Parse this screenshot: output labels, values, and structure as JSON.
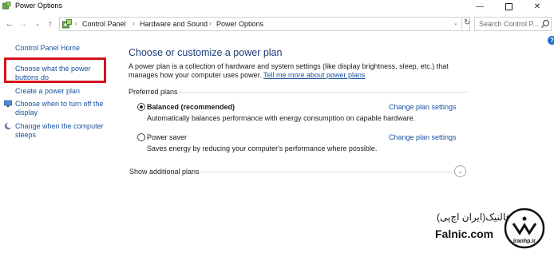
{
  "window": {
    "title": "Power Options",
    "minimize_glyph": "—",
    "close_glyph": "✕"
  },
  "address": {
    "back_glyph": "←",
    "forward_glyph": "→",
    "up_glyph": "↑",
    "dropdown_glyph": "⌄",
    "breadcrumb": [
      "Control Panel",
      "Hardware and Sound",
      "Power Options"
    ],
    "separator": "›",
    "refresh_glyph": "↻"
  },
  "search": {
    "placeholder": "Search Control P..."
  },
  "sidebar": {
    "home_label": "Control Panel Home",
    "items": [
      {
        "line1": "Choose what the power",
        "line2": "buttons do"
      },
      {
        "line1": "Create a power plan",
        "line2": ""
      },
      {
        "line1": "Choose when to turn off the",
        "line2": "display"
      },
      {
        "line1": "Change when the computer",
        "line2": "sleeps"
      }
    ]
  },
  "main": {
    "title": "Choose or customize a power plan",
    "intro_text": "A power plan is a collection of hardware and system settings (like display brightness, sleep, etc.) that manages how your computer uses power.",
    "intro_link": "Tell me more about power plans",
    "section_label": "Preferred plans",
    "plans": [
      {
        "name": "Balanced (recommended)",
        "description": "Automatically balances performance with energy consumption on capable hardware.",
        "link": "Change plan settings",
        "selected": true
      },
      {
        "name": "Power saver",
        "description": "Saves energy by reducing your computer's performance where possible.",
        "link": "Change plan settings",
        "selected": false
      }
    ],
    "show_additional": "Show additional plans",
    "expand_glyph": "⌄"
  },
  "help_glyph": "?",
  "watermark": {
    "fa_text": "فالنیک(ایران اچ‌پی)",
    "en_text": "Falnic.com",
    "logo_text": "iranhp.ir"
  },
  "colors": {
    "link": "#1a53a0",
    "title": "#1e3c78",
    "highlight": "#d5131c"
  }
}
